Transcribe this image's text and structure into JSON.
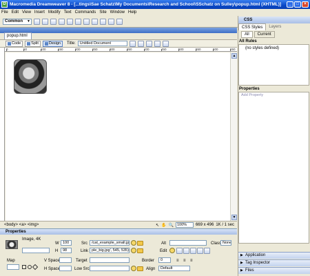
{
  "window": {
    "title": "Macromedia Dreamweaver 8 - [...tings\\Sae Schatz\\My Documents\\Research and School\\SSchatz on Sulley\\popup.html (XHTML)]"
  },
  "menu": [
    "File",
    "Edit",
    "View",
    "Insert",
    "Modify",
    "Text",
    "Commands",
    "Site",
    "Window",
    "Help"
  ],
  "insert_bar": {
    "category": "Common"
  },
  "document": {
    "tab": "popup.html",
    "view_buttons": [
      "Code",
      "Split",
      "Design"
    ],
    "title_label": "Title:",
    "title_value": "Untitled Document",
    "ruler_labels": [
      "0",
      "50",
      "100",
      "150",
      "200",
      "250",
      "300",
      "350",
      "400",
      "450",
      "500",
      "550",
      "600",
      "650"
    ]
  },
  "status_bar": {
    "tags": "<body> <a> <img>",
    "zoom": "100%",
    "size": "669 x 496",
    "download": "1K / 1 sec"
  },
  "properties": {
    "header": "Properties",
    "image_label": "Image, 4K",
    "w_label": "W",
    "w_value": "100",
    "h_label": "H",
    "h_value": "98",
    "src_label": "Src",
    "src_value": "/cat_example_small.jpg",
    "link_label": "Link",
    "link_value": "ple_big.jpg', 545, 535)",
    "alt_label": "Alt",
    "edit_label": "Edit",
    "class_label": "Class",
    "class_value": "None",
    "map_label": "Map",
    "vspace_label": "V Space",
    "hspace_label": "H Space",
    "target_label": "Target",
    "lowsrc_label": "Low Src",
    "border_label": "Border",
    "border_value": "0",
    "align_label": "Align",
    "align_value": "Default"
  },
  "right_panel": {
    "css_header": "CSS",
    "tabs": [
      "CSS Styles",
      "Layers"
    ],
    "subtabs": [
      "All",
      "Current"
    ],
    "all_rules_label": "All Rules",
    "rules_placeholder": "(no styles defined)",
    "properties_label": "Properties",
    "add_property": "Add Property",
    "collapsed_panels": [
      "Application",
      "Tag Inspector",
      "Files"
    ]
  },
  "colors": {
    "titlebar": "#0a49c8",
    "panel_header": "#a9bfe6",
    "background": "#ece9d8"
  }
}
